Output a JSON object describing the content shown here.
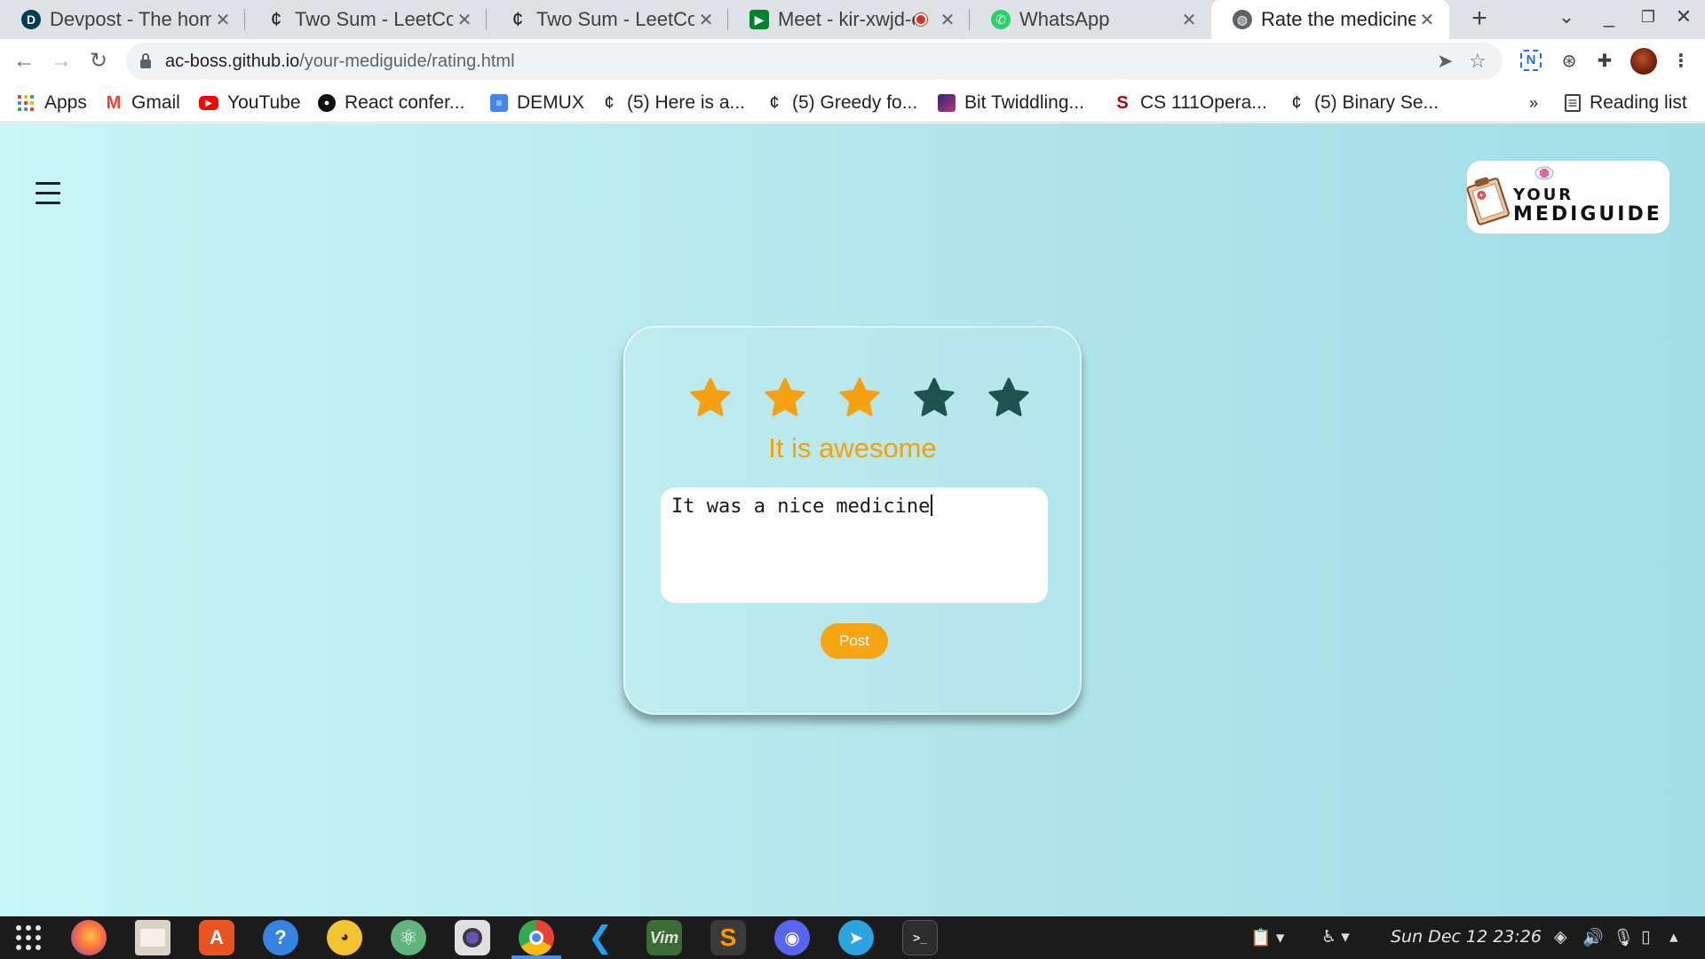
{
  "browser": {
    "tabs": [
      {
        "title": "Devpost - The home",
        "favicon": "devpost-icon"
      },
      {
        "title": "Two Sum - LeetCode",
        "favicon": "leetcode-icon"
      },
      {
        "title": "Two Sum - LeetCode",
        "favicon": "leetcode-icon"
      },
      {
        "title": "Meet - kir-xwjd-e",
        "favicon": "google-meet-icon",
        "recording": true
      },
      {
        "title": "WhatsApp",
        "favicon": "whatsapp-icon"
      },
      {
        "title": "Rate the medicine",
        "favicon": "globe-icon",
        "active": true
      }
    ],
    "address": {
      "host": "ac-boss.github.io",
      "path": "/your-mediguide/rating.html"
    },
    "bookmarks": [
      {
        "label": "Apps",
        "icon": "apps-grid-icon"
      },
      {
        "label": "Gmail",
        "icon": "gmail-icon"
      },
      {
        "label": "YouTube",
        "icon": "youtube-icon"
      },
      {
        "label": "React confer...",
        "icon": "github-icon"
      },
      {
        "label": "DEMUX",
        "icon": "google-docs-icon"
      },
      {
        "label": "(5) Here is a...",
        "icon": "leetcode-icon"
      },
      {
        "label": "(5) Greedy fo...",
        "icon": "leetcode-icon"
      },
      {
        "label": "Bit Twiddling...",
        "icon": "bit-twiddling-icon"
      },
      {
        "label": "CS 111Opera...",
        "icon": "stanford-icon"
      },
      {
        "label": "(5) Binary Se...",
        "icon": "leetcode-icon"
      }
    ],
    "overflow_label": "»",
    "reading_list": "Reading list"
  },
  "page": {
    "logo": {
      "line1": "YOUR",
      "line2": "MEDIGUIDE"
    },
    "rating": {
      "value": 3,
      "max": 5,
      "filled_color": "#f7a012",
      "empty_color": "#1d5450",
      "caption": "It is awesome"
    },
    "review": {
      "value": "It was a nice medicine",
      "placeholder": ""
    },
    "post_label": "Post",
    "accent_color": "#f7a512"
  },
  "taskbar": {
    "apps": [
      "launcher-icon",
      "firefox-icon",
      "files-icon",
      "software-store-icon",
      "help-icon",
      "pokemon-app-icon",
      "atom-icon",
      "camera-icon",
      "chrome-icon",
      "vscode-icon",
      "vim-icon",
      "sublime-text-icon",
      "discord-icon",
      "telegram-icon",
      "terminal-icon"
    ],
    "clock": "Sun Dec 12  23:26"
  }
}
